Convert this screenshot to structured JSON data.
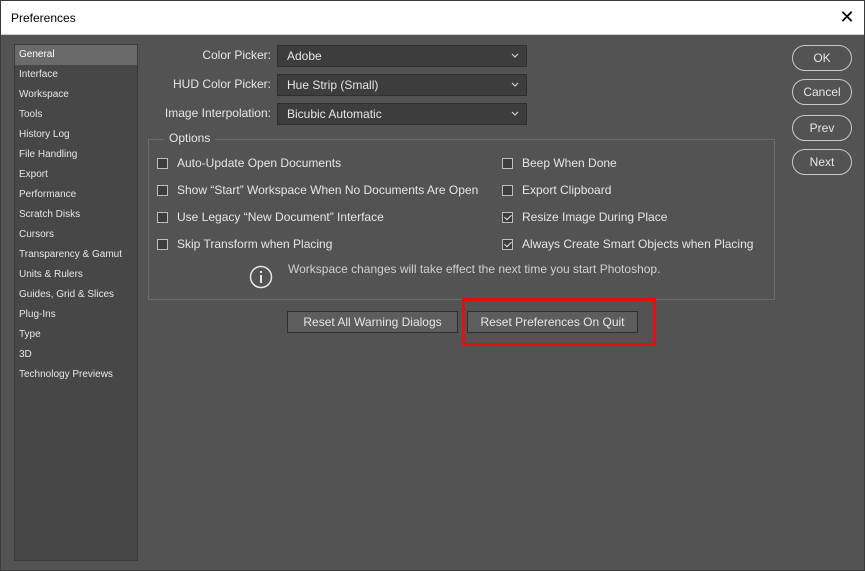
{
  "window": {
    "title": "Preferences",
    "close_glyph": "✕"
  },
  "sidebar": {
    "items": [
      {
        "label": "General",
        "selected": true
      },
      {
        "label": "Interface"
      },
      {
        "label": "Workspace"
      },
      {
        "label": "Tools"
      },
      {
        "label": "History Log"
      },
      {
        "label": "File Handling"
      },
      {
        "label": "Export"
      },
      {
        "label": "Performance"
      },
      {
        "label": "Scratch Disks"
      },
      {
        "label": "Cursors"
      },
      {
        "label": "Transparency & Gamut"
      },
      {
        "label": "Units & Rulers"
      },
      {
        "label": "Guides, Grid & Slices"
      },
      {
        "label": "Plug-Ins"
      },
      {
        "label": "Type"
      },
      {
        "label": "3D"
      },
      {
        "label": "Technology Previews"
      }
    ]
  },
  "fields": {
    "color_picker": {
      "label": "Color Picker:",
      "value": "Adobe"
    },
    "hud_color_picker": {
      "label": "HUD Color Picker:",
      "value": "Hue Strip (Small)"
    },
    "image_interpolation": {
      "label": "Image Interpolation:",
      "value": "Bicubic Automatic"
    }
  },
  "options": {
    "legend": "Options",
    "left": [
      {
        "label": "Auto-Update Open Documents",
        "checked": false
      },
      {
        "label": "Show “Start” Workspace When No Documents Are Open",
        "checked": false
      },
      {
        "label": "Use Legacy “New Document” Interface",
        "checked": false
      },
      {
        "label": "Skip Transform when Placing",
        "checked": false
      }
    ],
    "right": [
      {
        "label": "Beep When Done",
        "checked": false
      },
      {
        "label": "Export Clipboard",
        "checked": false
      },
      {
        "label": "Resize Image During Place",
        "checked": true
      },
      {
        "label": "Always Create Smart Objects when Placing",
        "checked": true
      }
    ],
    "info_text": "Workspace changes will take effect the next time you start Photoshop."
  },
  "buttons": {
    "reset_warnings": "Reset All Warning Dialogs",
    "reset_prefs": "Reset Preferences On Quit",
    "ok": "OK",
    "cancel": "Cancel",
    "prev": "Prev",
    "next": "Next"
  },
  "colors": {
    "highlight": "#e01018",
    "background": "#535353"
  }
}
